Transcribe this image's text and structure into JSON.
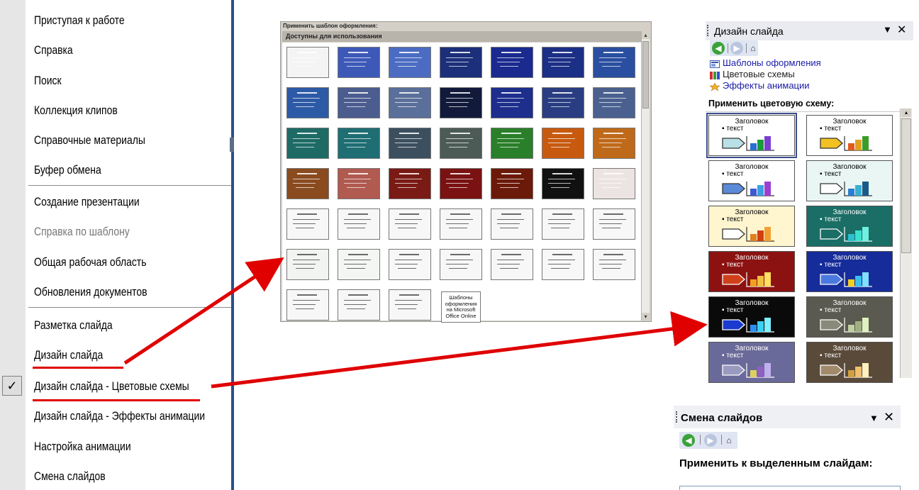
{
  "menu": {
    "items": [
      {
        "label": "Приступая к работе",
        "enabled": true
      },
      {
        "label": "Справка",
        "enabled": true
      },
      {
        "label": "Поиск",
        "enabled": true
      },
      {
        "label": "Коллекция клипов",
        "enabled": true
      },
      {
        "label": "Справочные материалы",
        "enabled": true
      },
      {
        "label": "Буфер обмена",
        "enabled": true
      },
      {
        "label": "Создание презентации",
        "enabled": true
      },
      {
        "label": "Справка по шаблону",
        "enabled": false
      },
      {
        "label": "Общая рабочая область",
        "enabled": true
      },
      {
        "label": "Обновления документов",
        "enabled": true
      },
      {
        "label": "Разметка слайда",
        "enabled": true
      },
      {
        "label": "Дизайн слайда",
        "enabled": true
      },
      {
        "label": "Дизайн слайда - Цветовые схемы",
        "enabled": true,
        "checked": true
      },
      {
        "label": "Дизайн слайда - Эффекты анимации",
        "enabled": true
      },
      {
        "label": "Настройка анимации",
        "enabled": true
      },
      {
        "label": "Смена слайдов",
        "enabled": true
      }
    ],
    "check_mark": "✓"
  },
  "template_picker": {
    "title": "Применить шаблон оформления:",
    "section": "Доступны для использования",
    "online_cell_text": "Шаблоны оформления на Microsoft Office Online",
    "thumbnail_colors": [
      [
        "#f4f4f4",
        "#3d59b8",
        "#4b6cc2",
        "#1b2f7a",
        "#1a2a8f",
        "#1c2f86",
        "#2a4fa0"
      ],
      [
        "#2d5aa6",
        "#4b5c8f",
        "#5a6f99",
        "#111a3a",
        "#1d2e8c",
        "#2a3d82",
        "#4a6190"
      ],
      [
        "#1e6b66",
        "#1f6e73",
        "#3c4f5e",
        "#4c5b55",
        "#2a7f2a",
        "#c85a10",
        "#bf6a1a"
      ],
      [
        "#8a4b1f",
        "#b05a50",
        "#7a1a14",
        "#7a1212",
        "#6b1a0a",
        "#111111",
        "#ece4e2"
      ],
      [
        "#f7f7f7",
        "#f7f7f7",
        "#f7f7f7",
        "#f7f7f7",
        "#f7f7f7",
        "#f7f7f7",
        "#f7f7f7"
      ],
      [
        "#f1f4f1",
        "#f4f6f4",
        "#f7f7f7",
        "#f7f7f7",
        "#f7f7f7",
        "#f7f7f7",
        "#f7f7f7"
      ],
      [
        "#f7f7f7",
        "#f7f7f7",
        "#f7f7f7"
      ]
    ]
  },
  "design_pane": {
    "title": "Дизайн слайда",
    "links": [
      "Шаблоны оформления",
      "Цветовые схемы",
      "Эффекты анимации"
    ],
    "section": "Применить цветовую схему:",
    "scheme_heading": "Заголовок",
    "scheme_text": "▪ текст",
    "schemes": [
      {
        "bg": "#ffffff",
        "fg": "#000000",
        "arrow": "#b8e0e6",
        "bars": [
          "#2a6fd1",
          "#1a9c3a",
          "#7b3fd0"
        ]
      },
      {
        "bg": "#ffffff",
        "fg": "#000000",
        "arrow": "#f2c222",
        "bars": [
          "#e05a1a",
          "#e0a020",
          "#3c9c2a"
        ]
      },
      {
        "bg": "#ffffff",
        "fg": "#000000",
        "arrow": "#5b8ad8",
        "bars": [
          "#3c5ad1",
          "#3aa0e0",
          "#9b3fd0"
        ]
      },
      {
        "bg": "#e9f6f4",
        "fg": "#000000",
        "arrow": "#ffffff",
        "bars": [
          "#2a7fd1",
          "#3ab0d0",
          "#1a5a8a"
        ]
      },
      {
        "bg": "#fff5cf",
        "fg": "#000000",
        "arrow": "#ffffff",
        "bars": [
          "#e08020",
          "#d04010",
          "#f0a030"
        ]
      },
      {
        "bg": "#1a6e66",
        "fg": "#ffffff",
        "arrow": "#1a6e66",
        "bars": [
          "#2ac0d0",
          "#3ae0d0",
          "#70f0e0"
        ]
      },
      {
        "bg": "#8c1212",
        "fg": "#ffffff",
        "arrow": "#d0401a",
        "bars": [
          "#f0a020",
          "#f0c040",
          "#ffe060"
        ]
      },
      {
        "bg": "#162c9a",
        "fg": "#ffffff",
        "arrow": "#4a7ae0",
        "bars": [
          "#f0d020",
          "#3ac0f0",
          "#80e0ff"
        ]
      },
      {
        "bg": "#0a0a0a",
        "fg": "#ffffff",
        "arrow": "#1a3ad0",
        "bars": [
          "#2a90f0",
          "#3ad0f0",
          "#80f0ff"
        ]
      },
      {
        "bg": "#5a5a50",
        "fg": "#ffffff",
        "arrow": "#8a8a7a",
        "bars": [
          "#c0d0a0",
          "#a0b080",
          "#e0f0c0"
        ]
      },
      {
        "bg": "#6a6a9a",
        "fg": "#ffffff",
        "arrow": "#9a9ac0",
        "bars": [
          "#e0d060",
          "#9060c0",
          "#c0b0f0"
        ]
      },
      {
        "bg": "#5a4a3a",
        "fg": "#ffffff",
        "arrow": "#a08a6a",
        "bars": [
          "#d0a040",
          "#f0c070",
          "#fff0c0"
        ]
      }
    ]
  },
  "transition_pane": {
    "title": "Смена слайдов",
    "apply_label": "Применить к выделенным слайдам:"
  },
  "colors": {
    "accent_red": "#e00000",
    "pane_header": "#e9ebf0",
    "link_blue": "#1a1aa6"
  }
}
